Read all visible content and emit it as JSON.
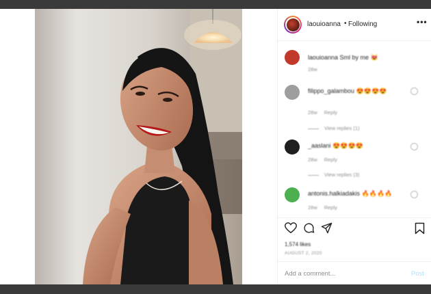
{
  "post": {
    "username": "laouioanna",
    "separator": "•",
    "follow_label": "Following",
    "more_label": "•••"
  },
  "comments": [
    {
      "username": "laouioanna",
      "text": "laouioanna Sml by me 😻",
      "time": "28w",
      "reply_label": "",
      "view_replies": "",
      "avatar_color": "#c0392b"
    },
    {
      "username": "filippo_galambou",
      "text": "filippo_galambou 😍😍😍😍",
      "time": "28w",
      "reply_label": "Reply",
      "view_replies": "View replies (1)",
      "avatar_color": "#9e9e9e"
    },
    {
      "username": "_aaslani",
      "text": "_aaslani 😍😍😍😍",
      "time": "28w",
      "reply_label": "Reply",
      "view_replies": "View replies (3)",
      "avatar_color": "#1f1f1f"
    },
    {
      "username": "antonis.halkiadakis",
      "text": "antonis.halkiadakis 🔥🔥🔥🔥",
      "time": "28w",
      "reply_label": "Reply",
      "view_replies": "",
      "avatar_color": "#4caf50"
    }
  ],
  "actions": {
    "likes_text": "1,574 likes",
    "date_text": "AUGUST 2, 2020"
  },
  "add_comment": {
    "placeholder": "Add a comment...",
    "post_label": "Post"
  },
  "colors": {
    "post_button": "#b2dffc",
    "ring_start": "#f58529",
    "ring_mid": "#dd2a7b"
  },
  "icons": [
    "heart-icon",
    "comment-icon",
    "share-icon",
    "bookmark-icon",
    "more-options-icon"
  ]
}
